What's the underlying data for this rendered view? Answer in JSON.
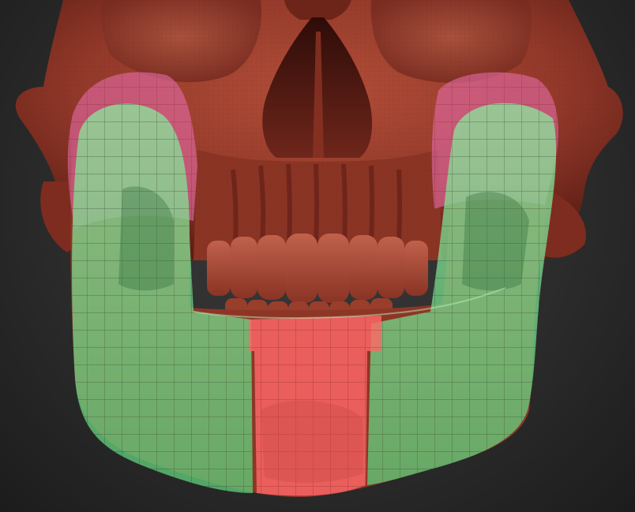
{
  "scene": {
    "subject": "skull-with-jaw-polygroups",
    "colors": {
      "background": "#2a2a2a",
      "bone": "#9b3c2b",
      "bone_dark": "#5a1a12",
      "bone_light": "#c0604a",
      "polygroup_green": "#72e08a",
      "polygroup_red": "#ff6b6b",
      "polygroup_pink": "#e66aa6",
      "wire": "#1d3a22"
    }
  }
}
